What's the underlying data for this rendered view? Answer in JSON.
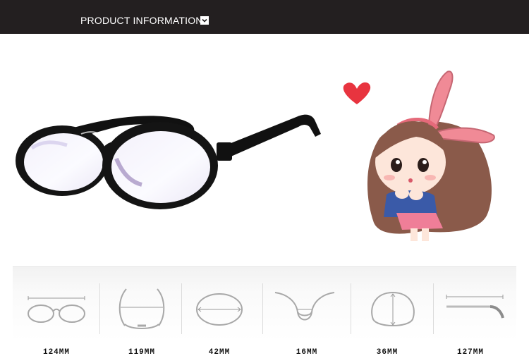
{
  "header": {
    "title": "PRODUCT INFORMATION",
    "toggle_icon": "chevron-down-icon",
    "background": "#231f20"
  },
  "product": {
    "frame_color": "#0d0d0d",
    "decoration": {
      "figure": "cartoon-girl-bunny-ears",
      "heart_color": "#e8343f"
    }
  },
  "measurements": [
    {
      "icon": "frame-width-icon",
      "value": "124MM"
    },
    {
      "icon": "front-depth-icon",
      "value": "119MM"
    },
    {
      "icon": "lens-width-icon",
      "value": "42MM"
    },
    {
      "icon": "bridge-width-icon",
      "value": "16MM"
    },
    {
      "icon": "lens-height-icon",
      "value": "36MM"
    },
    {
      "icon": "temple-length-icon",
      "value": "127MM"
    }
  ]
}
